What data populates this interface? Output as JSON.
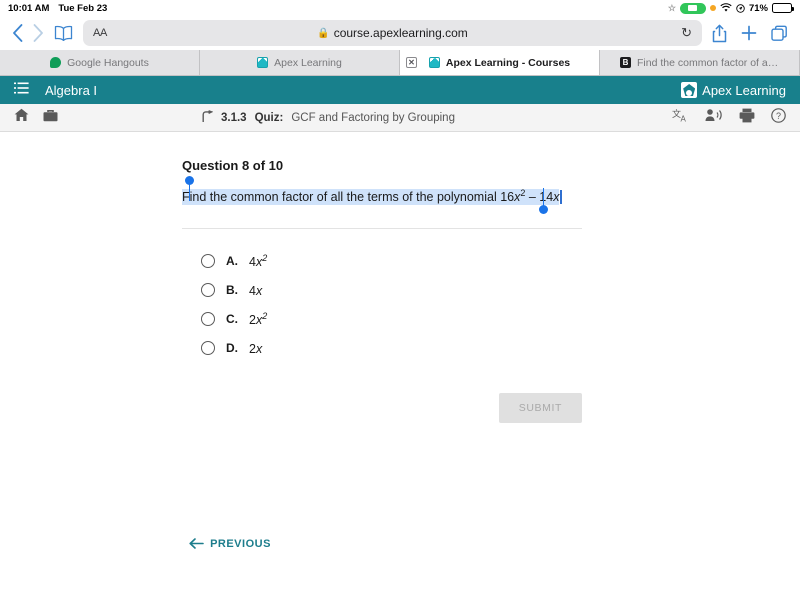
{
  "status_bar": {
    "time": "10:01 AM",
    "date": "Tue Feb 23",
    "battery_percent": "71%",
    "icons": [
      "star-icon",
      "screen-record-icon",
      "orange-privacy-dot-icon",
      "wifi-icon",
      "location-icon",
      "battery-icon"
    ]
  },
  "browser": {
    "url": "course.apexlearning.com",
    "text_size_label": "AA",
    "icons": [
      "back-icon",
      "forward-icon",
      "bookmarks-icon",
      "lock-icon",
      "reload-icon",
      "share-icon",
      "new-tab-icon",
      "show-tabs-icon"
    ],
    "tabs": [
      {
        "title": "Google Hangouts",
        "favicon": "hangouts-favicon",
        "active": false,
        "closable": false
      },
      {
        "title": "Apex Learning",
        "favicon": "apex-favicon",
        "active": false,
        "closable": true
      },
      {
        "title": "Apex Learning - Courses",
        "favicon": "apex-favicon",
        "active": true,
        "closable": true
      },
      {
        "title": "Find the common factor of all th...",
        "favicon": "brainly-favicon",
        "active": false,
        "closable": false
      }
    ]
  },
  "app_header": {
    "course_title": "Algebra I",
    "brand": "Apex Learning",
    "menu_icon": "hamburger-menu-icon",
    "accent_color": "#18808c"
  },
  "breadcrumb": {
    "number": "3.1.3",
    "kind": "Quiz:",
    "name": "GCF and Factoring by Grouping",
    "left_icons": [
      "home-icon",
      "briefcase-icon"
    ],
    "up_icon": "go-up-icon",
    "right_icons": [
      "translate-icon",
      "read-aloud-icon",
      "print-icon",
      "help-icon"
    ]
  },
  "question": {
    "heading": "Question 8 of 10",
    "prompt_prefix": "Find the common factor of all the terms of the polynomial 16",
    "var1": "x",
    "exp1": "2",
    "middle": " – 14",
    "var2": "x",
    "selection_color": "#cfe2fa",
    "options": [
      {
        "letter": "A.",
        "coefficient": "4",
        "variable": "x",
        "exponent": "2",
        "selected": false
      },
      {
        "letter": "B.",
        "coefficient": "4",
        "variable": "x",
        "exponent": "",
        "selected": false
      },
      {
        "letter": "C.",
        "coefficient": "2",
        "variable": "x",
        "exponent": "2",
        "selected": false
      },
      {
        "letter": "D.",
        "coefficient": "2",
        "variable": "x",
        "exponent": "",
        "selected": false
      }
    ],
    "submit_label": "SUBMIT",
    "submit_enabled": false
  },
  "footer": {
    "previous_label": "PREVIOUS",
    "previous_icon": "arrow-left-icon"
  }
}
